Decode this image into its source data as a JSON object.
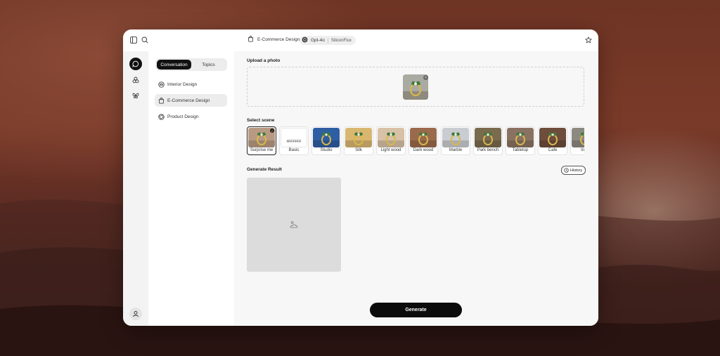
{
  "topbar": {
    "breadcrumb": "E-Commerce Design",
    "model": "Gpt-4o",
    "model_provider": "SiliconFlux"
  },
  "sidebar": {
    "segments": [
      {
        "label": "Conversation",
        "active": true
      },
      {
        "label": "Topics",
        "active": false
      }
    ],
    "items": [
      {
        "label": "Interior Design",
        "icon": "sofa-icon",
        "active": false
      },
      {
        "label": "E-Commerce Design",
        "icon": "shopping-bag-icon",
        "active": true
      },
      {
        "label": "Product Design",
        "icon": "aperture-icon",
        "active": false
      }
    ]
  },
  "main": {
    "upload_title": "Upload a photo",
    "scene_title": "Select scene",
    "result_title": "Generate Result",
    "history_label": "History",
    "generate_label": "Generate",
    "scenes": [
      {
        "label": "Surprise me",
        "bg": "#b89a82",
        "selected": true
      },
      {
        "label": "Basic",
        "bg": "#ffffff",
        "swatch": "#FFFFFF",
        "selected": false
      },
      {
        "label": "Studio",
        "bg": "#2f5fa3",
        "selected": false
      },
      {
        "label": "Silk",
        "bg": "#d9b771",
        "selected": false
      },
      {
        "label": "Light wood",
        "bg": "#d8c1a6",
        "selected": false
      },
      {
        "label": "Dark wood",
        "bg": "#9a6a4c",
        "selected": false
      },
      {
        "label": "Marble",
        "bg": "#c9ccd0",
        "selected": false
      },
      {
        "label": "Park bench",
        "bg": "#7a6a4e",
        "selected": false
      },
      {
        "label": "Tabletop",
        "bg": "#8a7262",
        "selected": false
      },
      {
        "label": "Cafe",
        "bg": "#6e4d3c",
        "selected": false
      },
      {
        "label": "Indu",
        "bg": "#8c8a80",
        "selected": false
      }
    ]
  }
}
